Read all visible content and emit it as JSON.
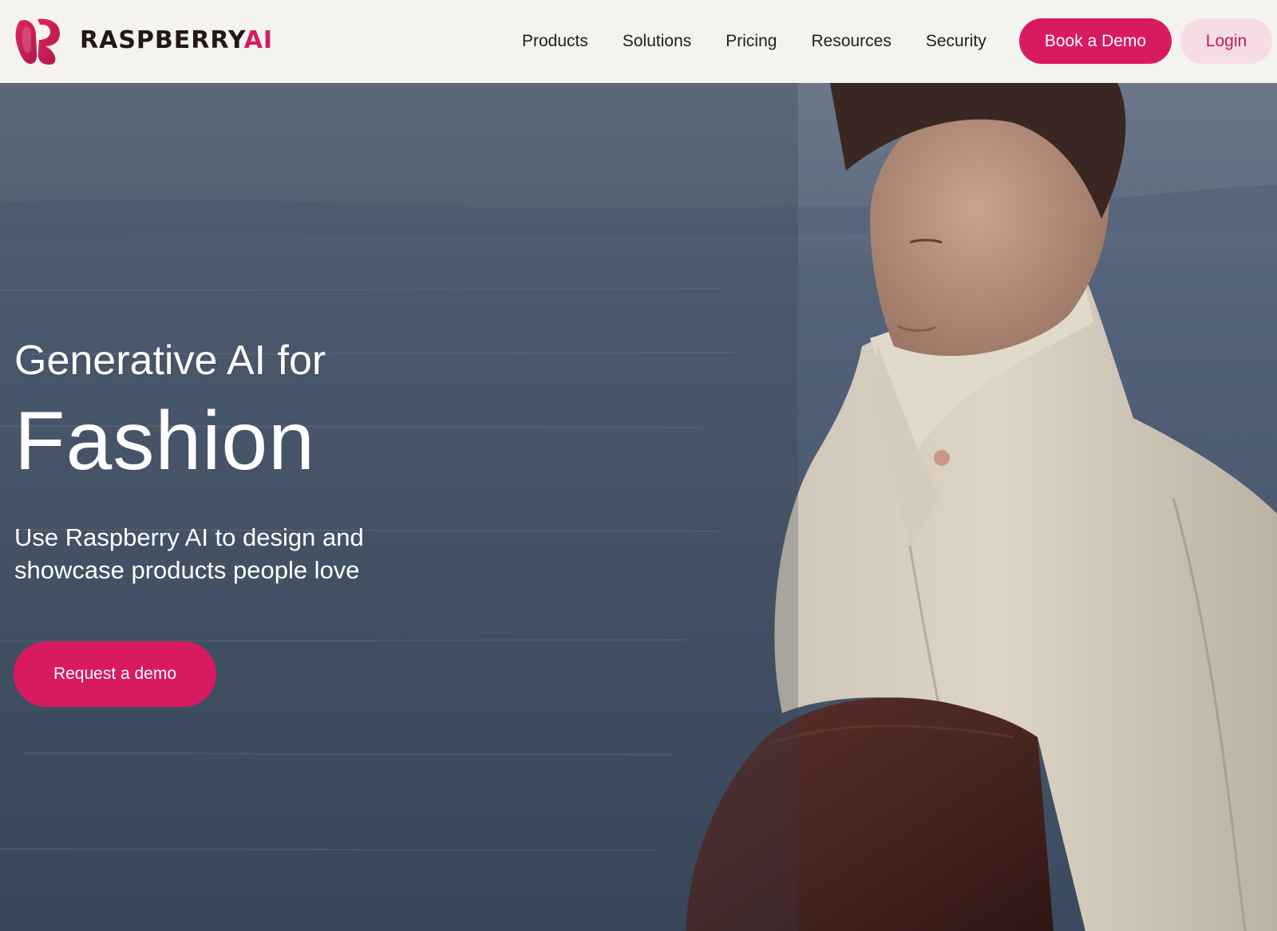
{
  "brand": {
    "name_main": "RASPBERRY",
    "name_accent": "AI",
    "logo_icon": "raspberry-r-logo",
    "accent_color": "#d81b60",
    "text_color": "#231717"
  },
  "nav": {
    "items": [
      {
        "label": "Products"
      },
      {
        "label": "Solutions"
      },
      {
        "label": "Pricing"
      },
      {
        "label": "Resources"
      },
      {
        "label": "Security"
      }
    ],
    "book_demo_label": "Book a Demo",
    "login_label": "Login"
  },
  "hero": {
    "kicker": "Generative AI for",
    "title": "Fashion",
    "subtitle": "Use Raspberry AI to design and showcase products people love",
    "cta_label": "Request a demo",
    "image_subject": "model-in-cream-coat-with-brown-leather-bag-by-sea"
  },
  "colors": {
    "primary": "#d81b60",
    "login_bg": "#f6dde4",
    "header_bg": "#f4f3f0",
    "hero_overlay": "#4a5a6f"
  }
}
